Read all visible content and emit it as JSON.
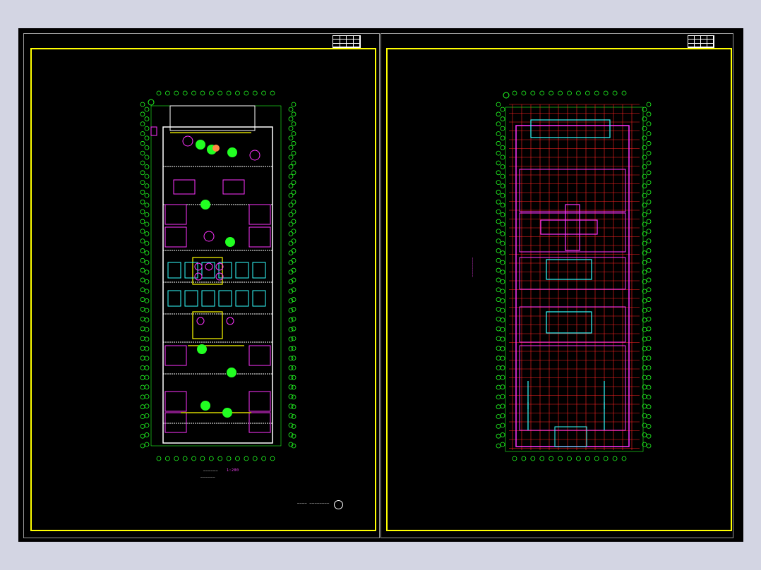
{
  "colors": {
    "background": "#d3d5e3",
    "canvas": "#000000",
    "frame": "#ffff00",
    "grid_bubble": "#22ff22",
    "wall": "#ffffff",
    "magenta": "#ff33ff",
    "red": "#ff2222",
    "cyan": "#33ffff"
  },
  "sheets": [
    {
      "name": "ground-floor-plan",
      "title_text": "——————",
      "scale_text": "1:200",
      "subtitle_text": "——————",
      "note_text": "———— ————————"
    },
    {
      "name": "roof-plan",
      "vertical_note": "————————"
    }
  ],
  "icons": [
    "north-arrow-icon",
    "axis-bubble-icon"
  ]
}
